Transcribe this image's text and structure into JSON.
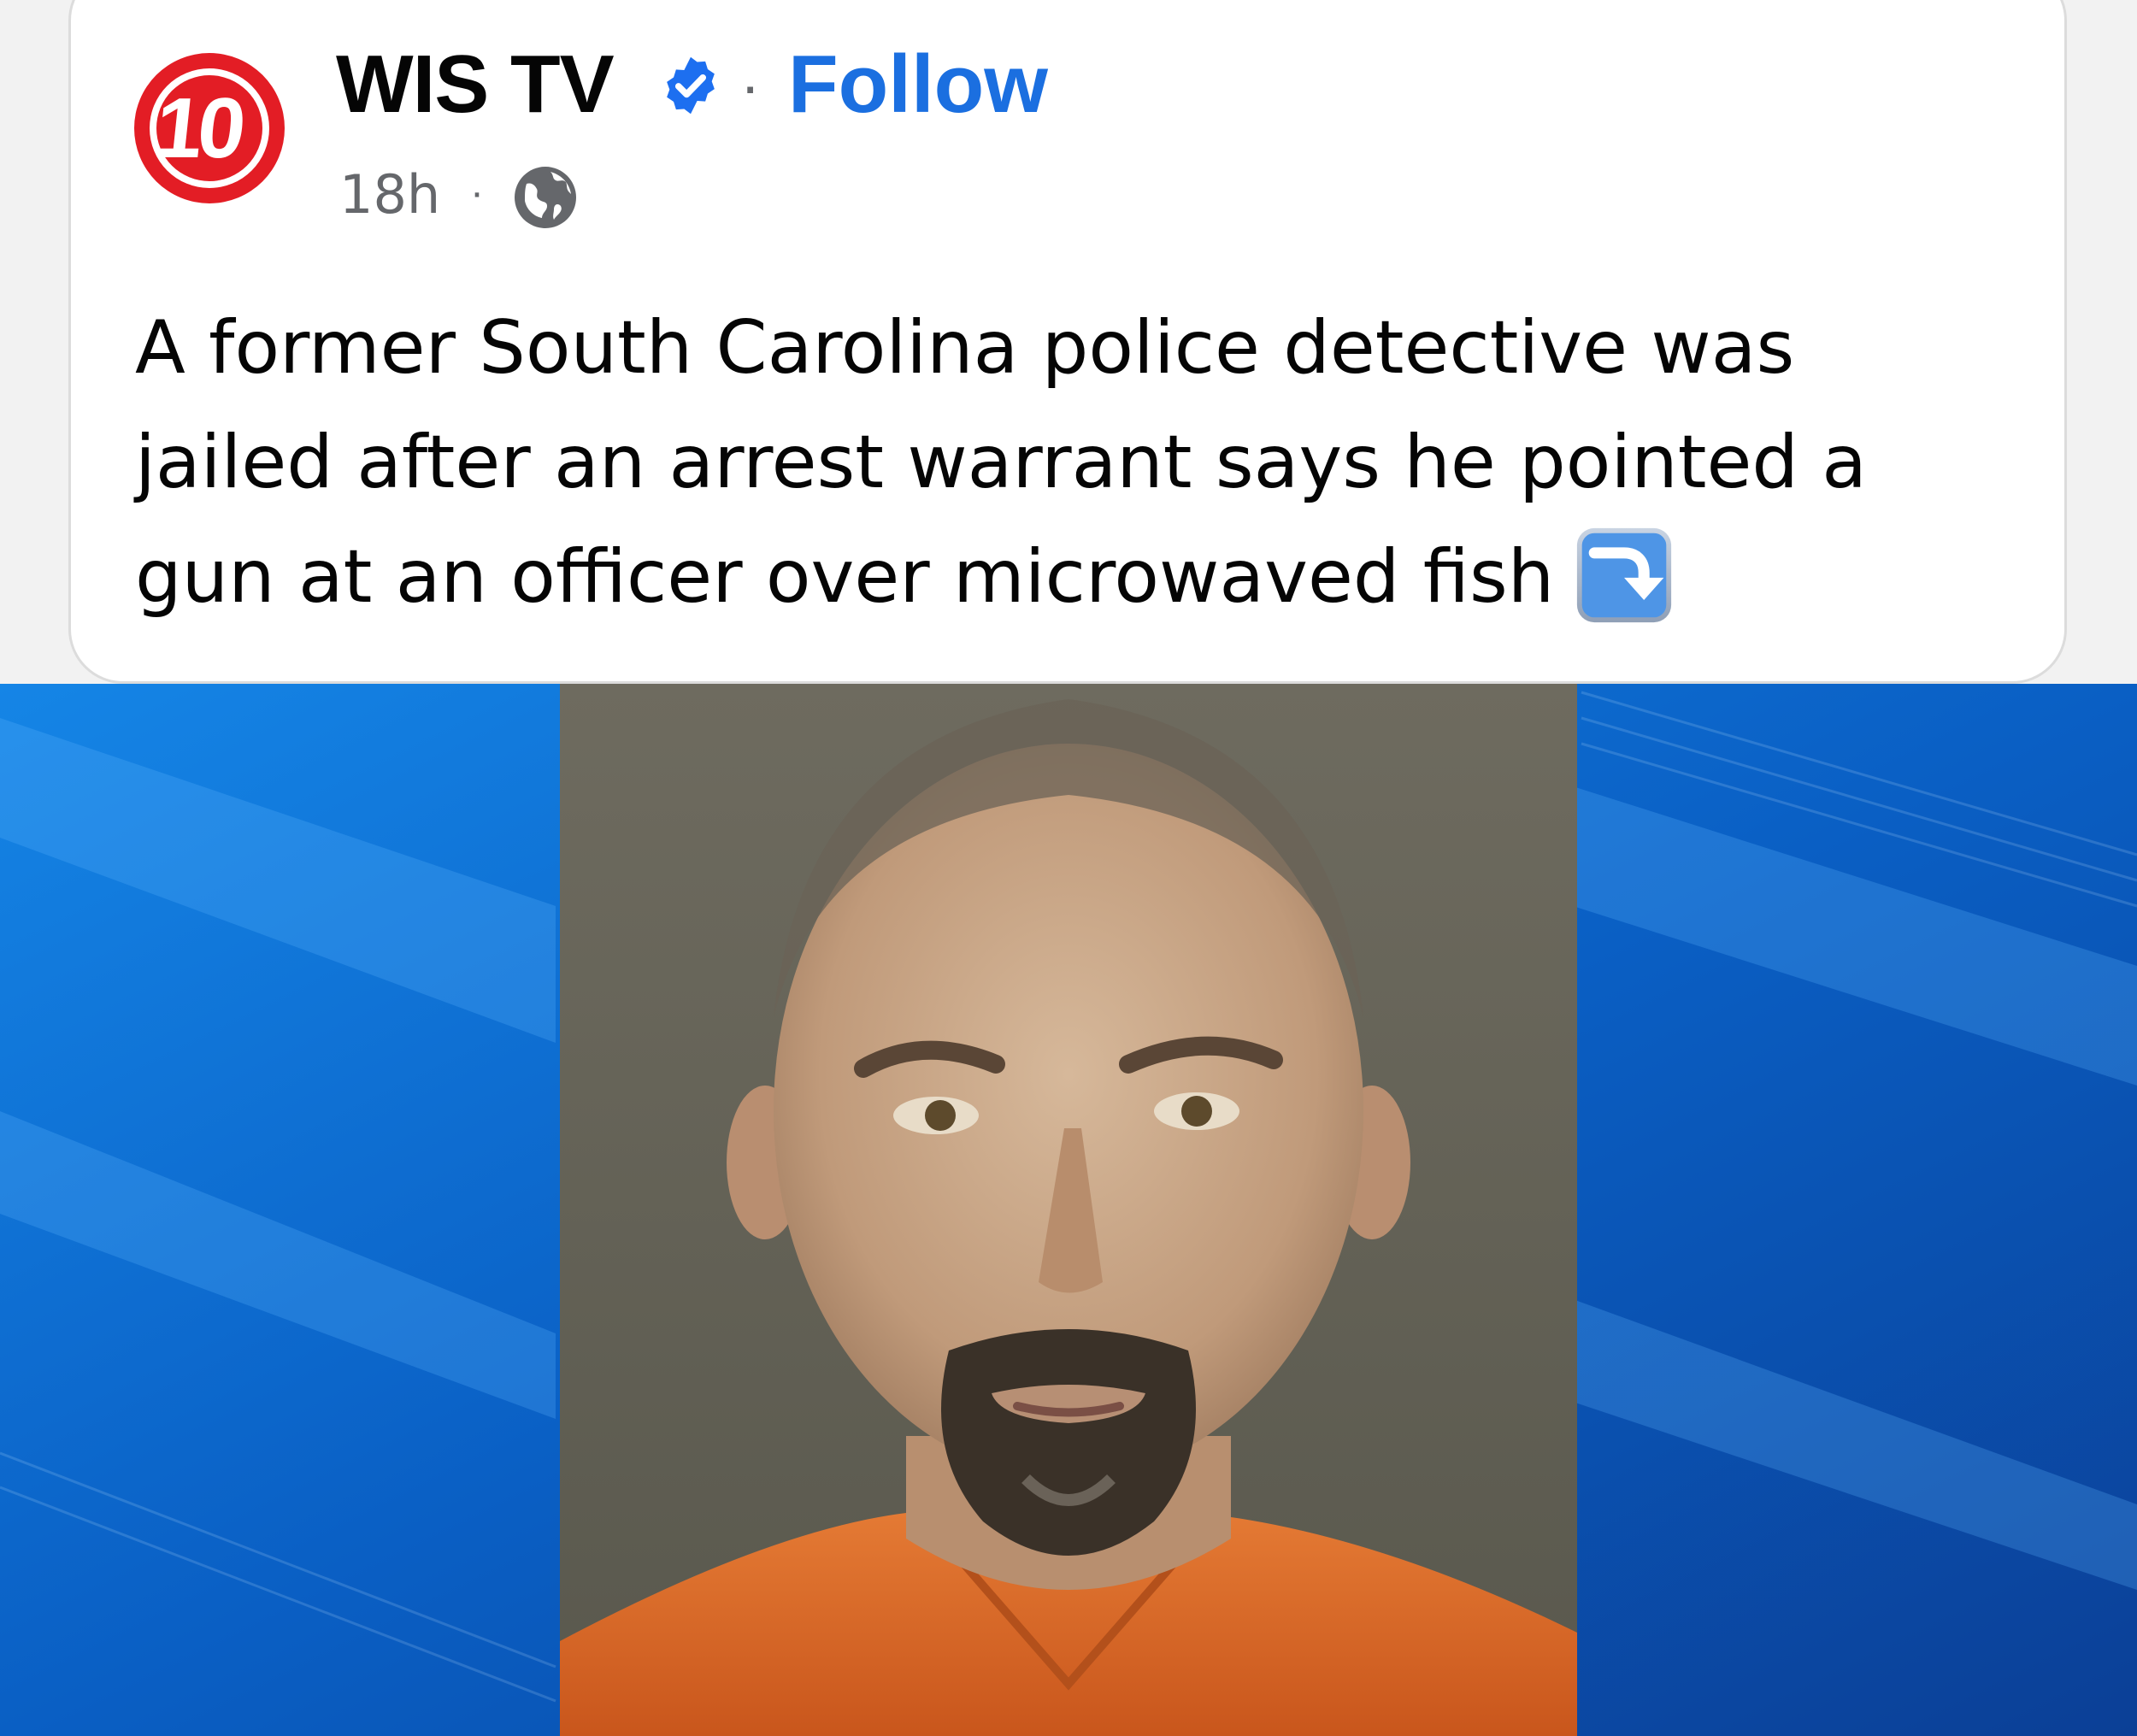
{
  "post": {
    "author": {
      "name": "WIS TV",
      "avatar_text": "10",
      "verified_icon": "verified-badge-icon"
    },
    "separator": "·",
    "follow_label": "Follow",
    "timestamp": "18h",
    "meta_separator": "·",
    "audience_icon": "globe-icon",
    "text_lines": [
      "A former South Carolina police detective was",
      "jailed after an arrest warrant says he pointed a",
      "gun at an officer over microwaved fish"
    ],
    "text_emoji_icon": "arrow-curving-down-emoji-icon",
    "image": {
      "subject": "mugshot-photo",
      "background": "blue-news-graphic"
    }
  },
  "colors": {
    "follow_blue": "#1b6fe0",
    "verified_blue": "#1d6ff0",
    "logo_red": "#e31d25",
    "text_primary": "#050505",
    "text_secondary": "#65676b",
    "news_blue": "#0a5fc4",
    "jumpsuit_orange": "#e06a28"
  }
}
